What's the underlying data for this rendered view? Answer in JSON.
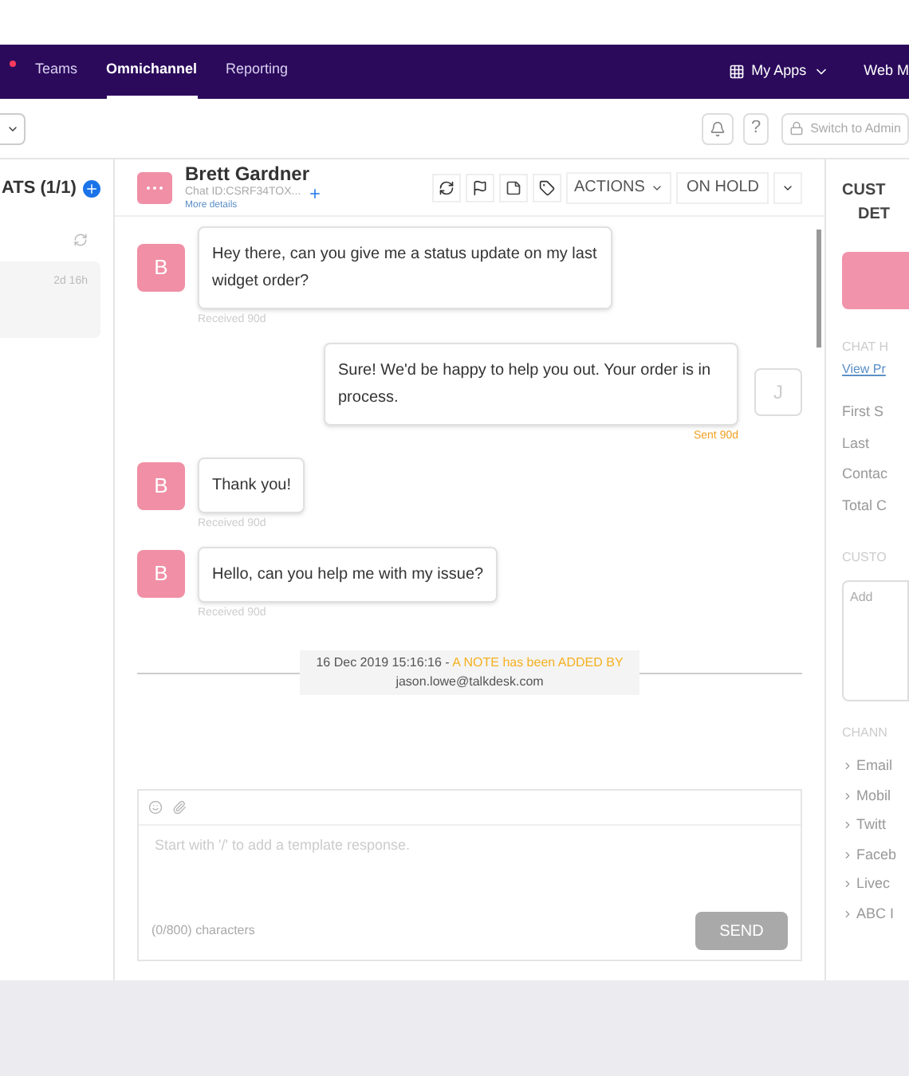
{
  "nav": {
    "tabs": [
      {
        "label": "Teams",
        "selected": false
      },
      {
        "label": "Omnichannel",
        "selected": true
      },
      {
        "label": "Reporting",
        "selected": false
      }
    ],
    "apps": "My Apps",
    "cut_item": "Web M"
  },
  "toolbar": {
    "help": "?",
    "switch_button": "Switch to Admin"
  },
  "chats_panel": {
    "title": "ATS (1/1)",
    "items": [
      {
        "time": "2d 16h",
        "selected": true
      }
    ]
  },
  "conversation": {
    "name": "Brett Gardner",
    "chat_id": "Chat ID:CSRF34TOX...",
    "more": "More details",
    "actions": "ACTIONS",
    "status": "ON HOLD"
  },
  "messages": [
    {
      "kind": "inbound",
      "avatar": "B",
      "text": "Hey there, can you give me a status update on my last widget order?",
      "meta": "Received 90d"
    },
    {
      "kind": "outbound",
      "avatar": "J",
      "text": "Sure! We'd be happy to help you out. Your order is in process.",
      "meta": "Sent 90d"
    },
    {
      "kind": "inbound",
      "avatar": "B",
      "text": "Thank you!",
      "meta": "Received 90d"
    },
    {
      "kind": "inbound",
      "avatar": "B",
      "text": "Hello, can you help me with my issue?",
      "meta": "Received 90d"
    }
  ],
  "note": {
    "time": "16 Dec 2019 15:16:16 - ",
    "action": "A NOTE has been ADDED BY",
    "author": "jason.lowe@talkdesk.com"
  },
  "composer": {
    "placeholder": "Start with '/' to add a template response.",
    "count": "(0/800) characters",
    "send": "SEND"
  },
  "details": {
    "title_1": "CUST",
    "title_2": "DET",
    "chat_heading": "CHAT H",
    "link": "View Pr",
    "fields": [
      "First S",
      "Last",
      "Contac",
      "Total C"
    ],
    "custom_heading": "CUSTO",
    "notes_placeholder": "Add",
    "channels_heading": "CHANN",
    "channels": [
      "Email",
      "Mobil",
      "Twitt",
      "Faceb",
      "Livec",
      "ABC I"
    ]
  }
}
